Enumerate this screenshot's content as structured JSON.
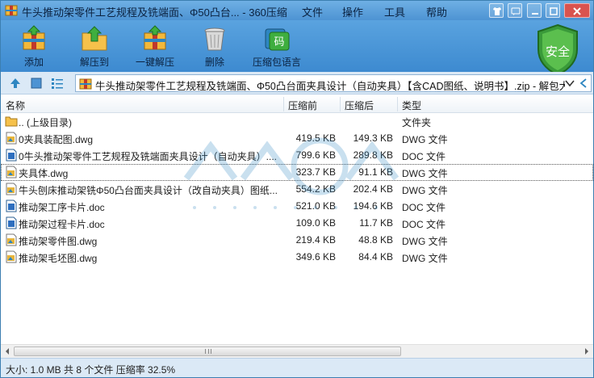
{
  "window": {
    "title": "牛头推动架零件工艺规程及铣端面、Φ50凸台... - 360压缩",
    "menu": [
      "文件",
      "操作",
      "工具",
      "帮助"
    ]
  },
  "toolbar": {
    "add_label": "添加",
    "extract_to_label": "解压到",
    "one_click_extract_label": "一键解压",
    "delete_label": "删除",
    "language_label": "压缩包语言",
    "language_icon_text": "码",
    "security_label": "安全"
  },
  "address": {
    "path": "牛头推动架零件工艺规程及铣端面、Φ50凸台面夹具设计（自动夹具）【含CAD图纸、说明书】.zip - 解包大小"
  },
  "columns": {
    "name": "名称",
    "size": "压缩前",
    "packed": "压缩后",
    "type": "类型"
  },
  "files": [
    {
      "name": ".. (上级目录)",
      "size": "",
      "packed": "",
      "type": "文件夹",
      "icon": "folder-icon"
    },
    {
      "name": "0夹具装配图.dwg",
      "size": "419.5 KB",
      "packed": "149.3 KB",
      "type": "DWG 文件",
      "icon": "dwg-file-icon"
    },
    {
      "name": "0牛头推动架零件工艺规程及铣端面夹具设计（自动夹具）....",
      "size": "799.6 KB",
      "packed": "289.8 KB",
      "type": "DOC 文件",
      "icon": "doc-file-icon"
    },
    {
      "name": "夹具体.dwg",
      "size": "323.7 KB",
      "packed": "91.1 KB",
      "type": "DWG 文件",
      "icon": "dwg-file-icon"
    },
    {
      "name": "牛头刨床推动架铣Φ50凸台面夹具设计（改自动夹具）图纸...",
      "size": "554.2 KB",
      "packed": "202.4 KB",
      "type": "DWG 文件",
      "icon": "dwg-file-icon"
    },
    {
      "name": "推动架工序卡片.doc",
      "size": "521.0 KB",
      "packed": "194.6 KB",
      "type": "DOC 文件",
      "icon": "doc-file-icon"
    },
    {
      "name": "推动架过程卡片.doc",
      "size": "109.0 KB",
      "packed": "11.7 KB",
      "type": "DOC 文件",
      "icon": "doc-file-icon"
    },
    {
      "name": "推动架零件图.dwg",
      "size": "219.4 KB",
      "packed": "48.8 KB",
      "type": "DWG 文件",
      "icon": "dwg-file-icon"
    },
    {
      "name": "推动架毛坯图.dwg",
      "size": "349.6 KB",
      "packed": "84.4 KB",
      "type": "DWG 文件",
      "icon": "dwg-file-icon"
    }
  ],
  "status": {
    "text": "大小: 1.0 MB 共 8 个文件 压缩率 32.5%"
  },
  "colors": {
    "titlebar": "#5aa3df",
    "status_bg": "#dbe9f6",
    "shield": "#3a9a3a"
  }
}
